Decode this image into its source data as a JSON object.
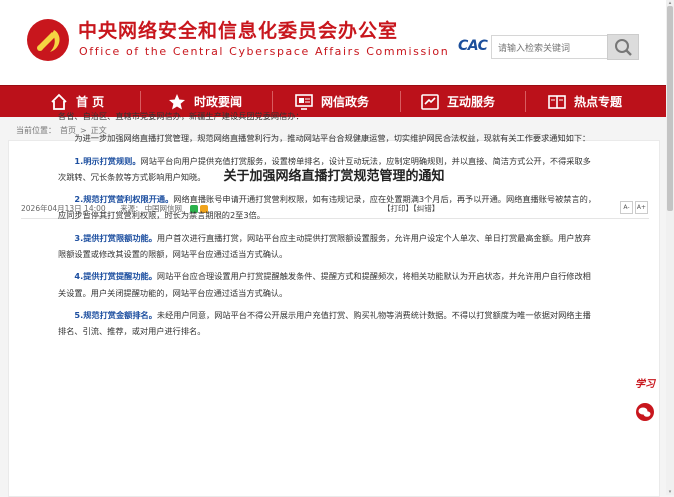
{
  "header": {
    "title_cn": "中央网络安全和信息化委员会办公室",
    "title_en": "Office of the Central Cyberspace Affairs Commission",
    "logo_text": "CAC",
    "search_placeholder": "请输入检索关键词"
  },
  "nav": {
    "items": [
      {
        "label": "首 页",
        "icon": "home-icon"
      },
      {
        "label": "时政要闻",
        "icon": "star-icon"
      },
      {
        "label": "网信政务",
        "icon": "monitor-icon"
      },
      {
        "label": "互动服务",
        "icon": "handshake-icon"
      },
      {
        "label": "热点专题",
        "icon": "book-icon"
      }
    ]
  },
  "breadcrumb": {
    "prefix": "当前位置：",
    "home": "首页",
    "sep": ">",
    "current": "正文"
  },
  "article": {
    "title": "关于加强网络直播打赏规范管理的通知",
    "date": "2026年04月13日 14:00",
    "source_label": "来源：",
    "source": "中国网信网",
    "print_label": "【打印】",
    "errata_label": "【纠错】",
    "font_small": "A-",
    "font_large": "A+",
    "salutation": "各省、自治区、直辖市党委网信办，新疆生产建设兵团党委网信办：",
    "intro": "为进一步加强网络直播打赏管理，规范网络直播营利行为，推动网站平台合规健康运营，切实维护网民合法权益，现就有关工作要求通知如下：",
    "items": [
      {
        "heading": "1.明示打赏规则。",
        "text": "网站平台向用户提供充值打赏服务，设置榜单排名，设计互动玩法，应制定明确规则，并以直接、简洁方式公开，不得采取多次跳转、冗长条款等方式影响用户知晓。"
      },
      {
        "heading": "2.规范打赏营利权限开通。",
        "text": "网络直播账号申请开通打赏营利权限，如有违规记录，应在处置期满3个月后，再予以开通。网络直播账号被禁言的，应同步暂停其打赏营利权限，时长为禁言期限的2至3倍。"
      },
      {
        "heading": "3.提供打赏限额功能。",
        "text": "用户首次进行直播打赏，网站平台应主动提供打赏限额设置服务，允许用户设定个人单次、单日打赏最高金额。用户放弃限额设置或修改其设置的限额，网站平台应通过适当方式确认。"
      },
      {
        "heading": "4.提供打赏提醒功能。",
        "text": "网站平台应合理设置用户打赏提醒触发条件、提醒方式和提醒频次，将相关功能默认为开启状态，并允许用户自行修改相关设置。用户关闭提醒功能的，网站平台应通过适当方式确认。"
      },
      {
        "heading": "5.规范打赏金额排名。",
        "text": "未经用户同意，网站平台不得公开展示用户充值打赏、购买礼物等消费统计数据。不得以打赏额度为唯一依据对网络主播排名、引流、推荐，或对用户进行排名。"
      }
    ]
  },
  "float": {
    "xuexi_label": "学习",
    "wechat_icon": "wechat-icon"
  },
  "colors": {
    "brand_red": "#c8161d",
    "nav_red": "#bb111a",
    "heading_blue": "#1d4fa0"
  }
}
